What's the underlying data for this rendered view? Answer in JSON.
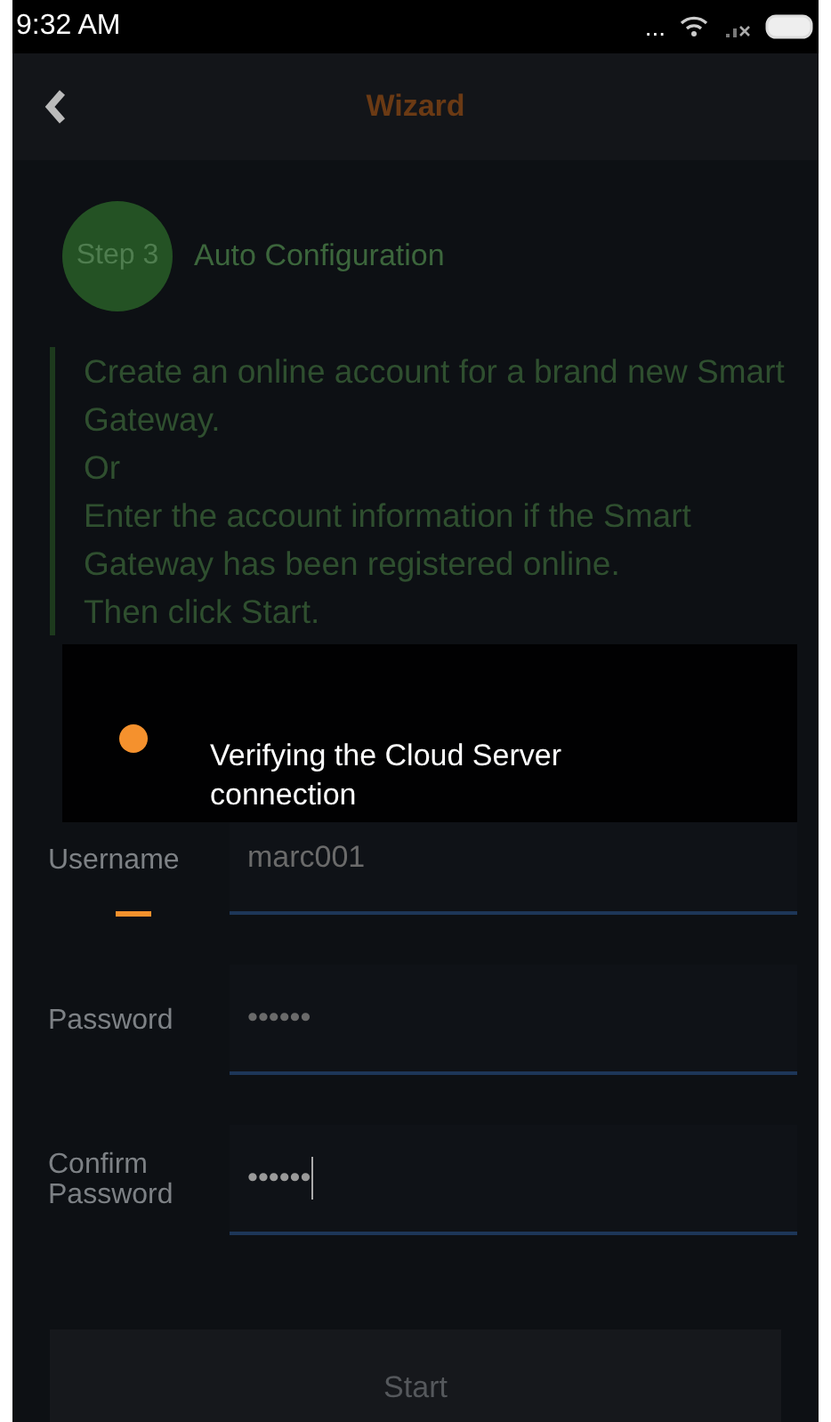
{
  "status_bar": {
    "time": "9:32 AM",
    "dots": "..."
  },
  "header": {
    "title": "Wizard"
  },
  "step": {
    "badge": "Step 3",
    "title": "Auto Configuration"
  },
  "instructions": [
    "Create an online account for a brand new Smart Gateway.",
    "Or",
    "Enter the account information if the Smart Gateway has been registered online.",
    "Then click Start."
  ],
  "fields": [
    {
      "label": "Username",
      "value": "marc001",
      "focused": false
    },
    {
      "label": "Password",
      "value": "••••••",
      "focused": false
    },
    {
      "label": "Confirm Password",
      "value": "••••••",
      "focused": true
    }
  ],
  "start_button": "Start",
  "dialog": {
    "message": "Verifying the Cloud Server connection"
  }
}
